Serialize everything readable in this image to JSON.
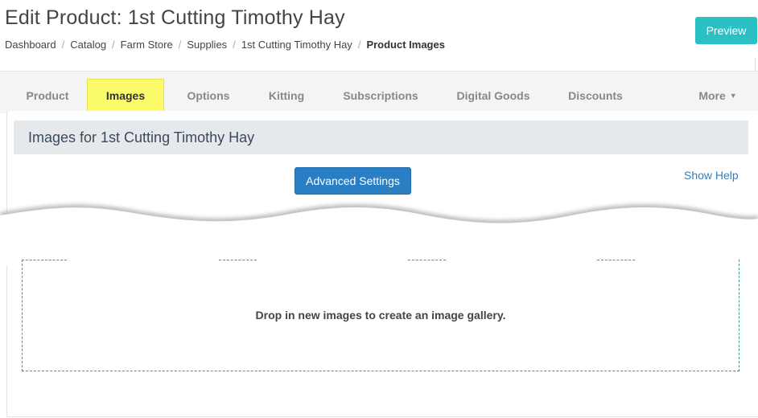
{
  "page": {
    "title": "Edit Product: 1st Cutting Timothy Hay",
    "preview_label": "Preview"
  },
  "breadcrumb": {
    "items": [
      "Dashboard",
      "Catalog",
      "Farm Store",
      "Supplies",
      "1st Cutting Timothy Hay"
    ],
    "current": "Product Images"
  },
  "tabs": [
    {
      "label": "Product"
    },
    {
      "label": "Images",
      "active": true
    },
    {
      "label": "Options"
    },
    {
      "label": "Kitting"
    },
    {
      "label": "Subscriptions"
    },
    {
      "label": "Digital Goods"
    },
    {
      "label": "Discounts"
    },
    {
      "label": "More"
    }
  ],
  "images_panel": {
    "heading": "Images for 1st Cutting Timothy Hay",
    "advanced_settings_label": "Advanced Settings",
    "show_help_label": "Show Help"
  },
  "dropzone": {
    "text": "Drop in new images to create an image gallery."
  },
  "colors": {
    "preview": "#2bc0c4",
    "primary": "#2a7fc4",
    "active_tab": "#fbfb6b",
    "link": "#3a7ab8"
  }
}
